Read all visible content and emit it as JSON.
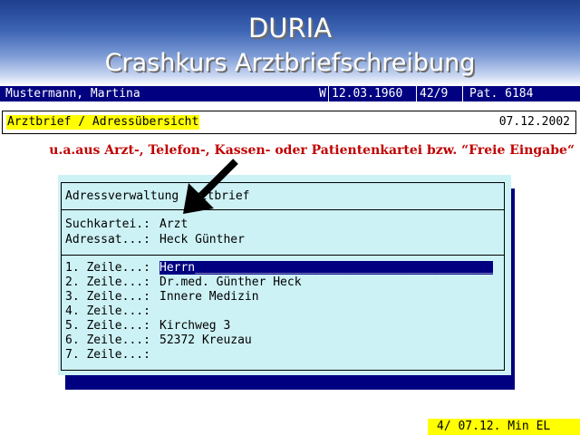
{
  "title": {
    "line1": "DURIA",
    "line2": "Crashkurs Arztbriefschreibung"
  },
  "patient_bar": {
    "name": "Mustermann, Martina",
    "sex": "W",
    "birthdate": "12.03.1960",
    "age": "42/9",
    "patient_no": "Pat. 6184"
  },
  "header": {
    "section": "Arztbrief / Adressübersicht",
    "date": "07.12.2002"
  },
  "annotation": "u.a.aus Arzt-, Telefon-, Kassen- oder Patientenkartei bzw. “Freie Eingabe“",
  "dialog": {
    "title": "Adressverwaltung Arztbrief",
    "suchkartei_label": "Suchkartei.:",
    "suchkartei_value": "Arzt",
    "adressat_label": "Adressat...:",
    "adressat_value": "Heck Günther",
    "lines": [
      {
        "label": "1. Zeile...:",
        "value": "Herrn"
      },
      {
        "label": "2. Zeile...:",
        "value": "Dr.med. Günther Heck"
      },
      {
        "label": "3. Zeile...:",
        "value": "Innere Medizin"
      },
      {
        "label": "4. Zeile...:",
        "value": ""
      },
      {
        "label": "5. Zeile...:",
        "value": "Kirchweg 3"
      },
      {
        "label": "6. Zeile...:",
        "value": "52372 Kreuzau"
      },
      {
        "label": "7. Zeile...:",
        "value": ""
      }
    ]
  },
  "status_bar": "4/ 07.12. Min EL",
  "colors": {
    "patient_bar": "#000080",
    "highlight": "#ffff00",
    "dialog_bg": "#cdf2f5",
    "annotation": "#c00000"
  },
  "icons": {
    "pointer": "arrow-icon"
  }
}
